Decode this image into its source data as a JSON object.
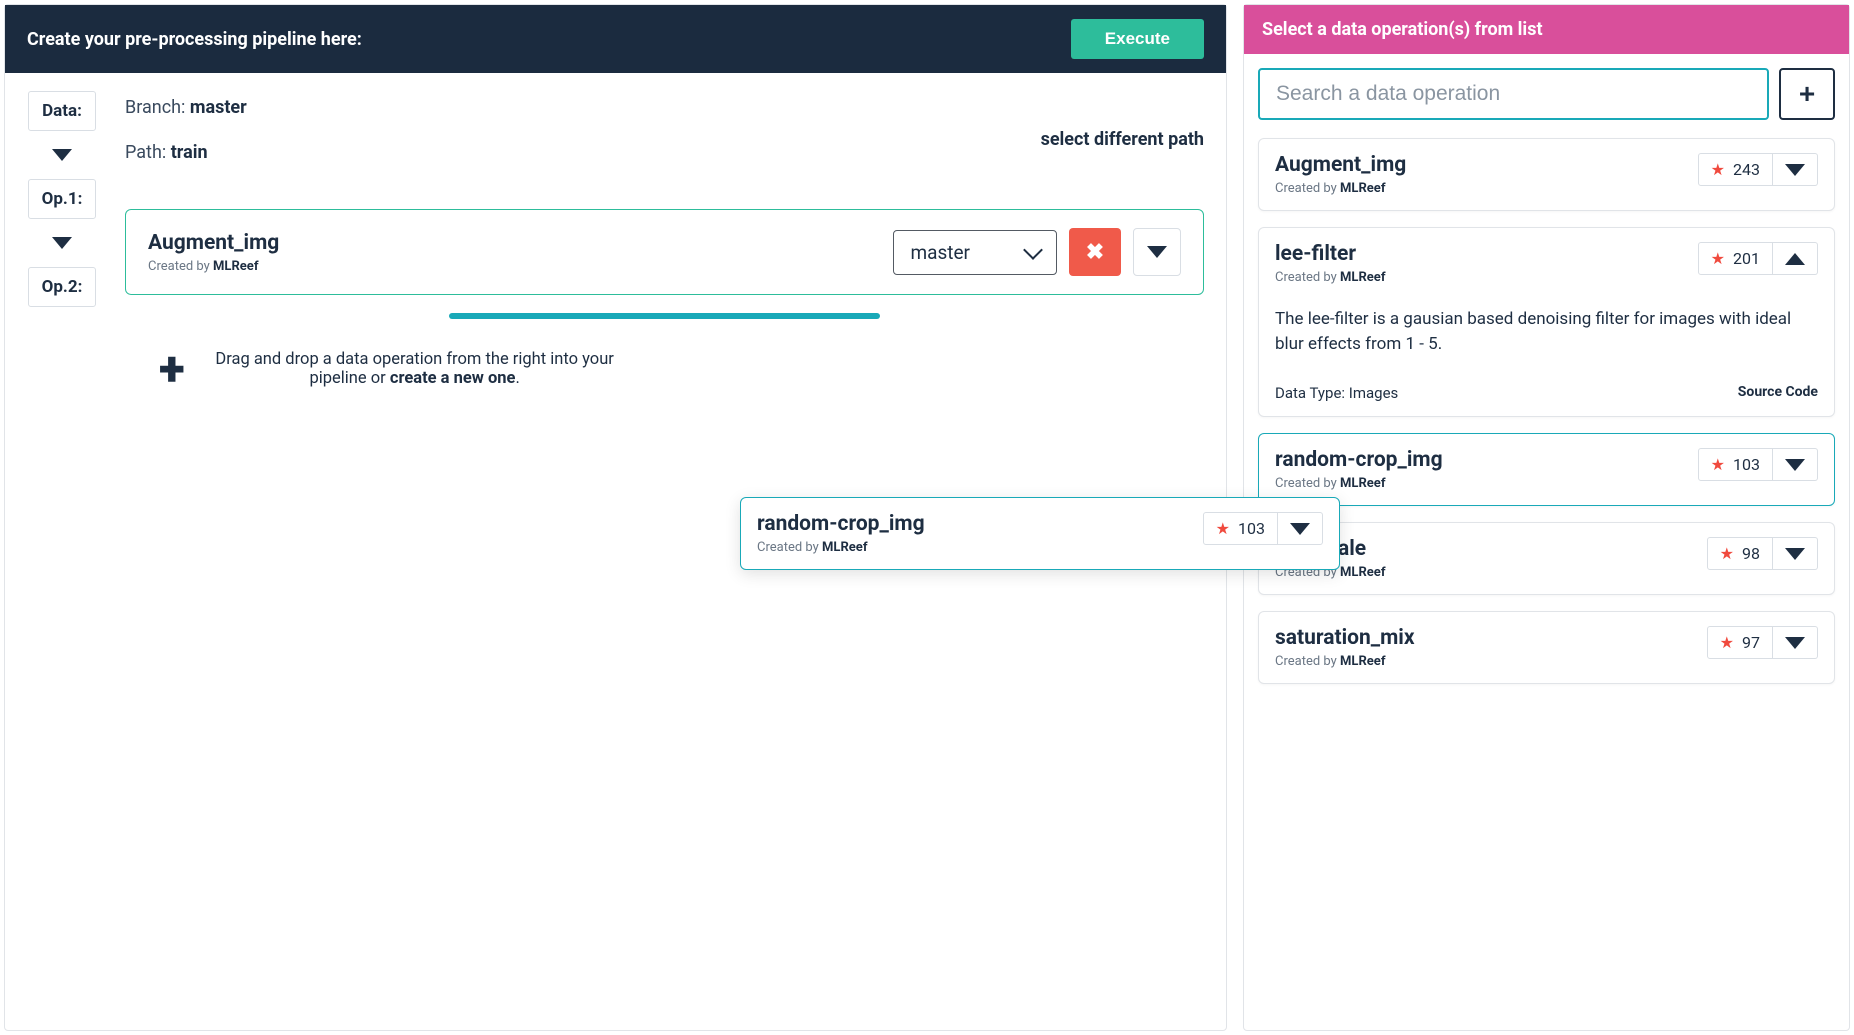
{
  "leftHeader": {
    "title": "Create your pre-processing pipeline here:",
    "executeLabel": "Execute"
  },
  "steps": {
    "data": "Data:",
    "op1": "Op.1:",
    "op2": "Op.2:"
  },
  "branch": {
    "label": "Branch: ",
    "value": "master"
  },
  "path": {
    "label": "Path: ",
    "value": "train"
  },
  "selectDifferentPath": "select different path",
  "pipelineOp": {
    "title": "Augment_img",
    "createdBy": "Created by ",
    "author": "MLReef",
    "branchSelected": "master"
  },
  "dropZone": {
    "text1": "Drag and drop a data operation from the right into your pipeline or ",
    "text2": "create a new one",
    "text3": "."
  },
  "rightHeader": {
    "title": "Select a data operation(s) from list"
  },
  "search": {
    "placeholder": "Search a data operation"
  },
  "operations": [
    {
      "title": "Augment_img",
      "author": "MLReef",
      "stars": "243",
      "expanded": false,
      "active": false
    },
    {
      "title": "lee-filter",
      "author": "MLReef",
      "stars": "201",
      "expanded": true,
      "active": false,
      "description": "The lee-filter is a gausian based denoising filter for images with ideal blur effects from 1 - 5.",
      "dataType": "Data Type: Images",
      "sourceCode": "Source Code"
    },
    {
      "title": "random-crop_img",
      "author": "MLReef",
      "stars": "103",
      "expanded": false,
      "active": true
    },
    {
      "title": "greyscale",
      "author": "MLReef",
      "stars": "98",
      "expanded": false,
      "active": false
    },
    {
      "title": "saturation_mix",
      "author": "MLReef",
      "stars": "97",
      "expanded": false,
      "active": false
    }
  ],
  "dragged": {
    "title": "random-crop_img",
    "author": "MLReef",
    "stars": "103",
    "createdBy": "Created by "
  },
  "createdByLabel": "Created by "
}
